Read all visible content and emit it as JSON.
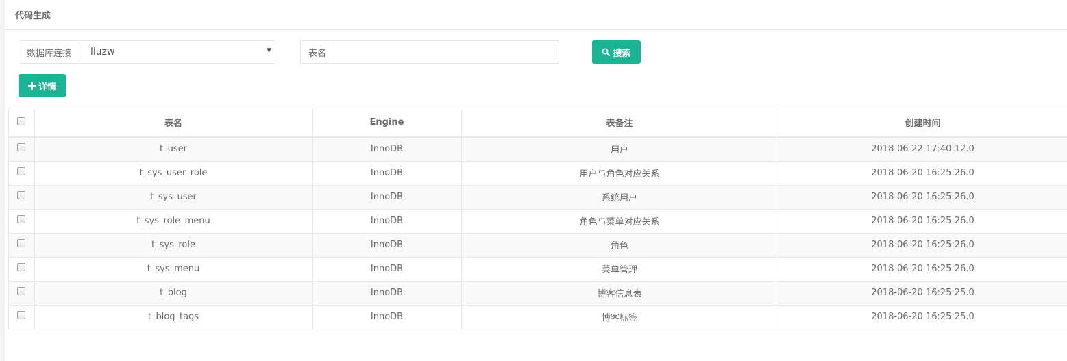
{
  "panel": {
    "title": "代码生成"
  },
  "filters": {
    "db_label": "数据库连接",
    "db_value": "liuzw",
    "table_label": "表名",
    "table_value": "",
    "search_label": "搜索"
  },
  "toolbar": {
    "detail_label": "详情"
  },
  "table": {
    "headers": [
      "表名",
      "Engine",
      "表备注",
      "创建时间"
    ],
    "rows": [
      {
        "name": "t_user",
        "engine": "InnoDB",
        "comment": "用户",
        "created": "2018-06-22 17:40:12.0"
      },
      {
        "name": "t_sys_user_role",
        "engine": "InnoDB",
        "comment": "用户与角色对应关系",
        "created": "2018-06-20 16:25:26.0"
      },
      {
        "name": "t_sys_user",
        "engine": "InnoDB",
        "comment": "系统用户",
        "created": "2018-06-20 16:25:26.0"
      },
      {
        "name": "t_sys_role_menu",
        "engine": "InnoDB",
        "comment": "角色与菜单对应关系",
        "created": "2018-06-20 16:25:26.0"
      },
      {
        "name": "t_sys_role",
        "engine": "InnoDB",
        "comment": "角色",
        "created": "2018-06-20 16:25:26.0"
      },
      {
        "name": "t_sys_menu",
        "engine": "InnoDB",
        "comment": "菜单管理",
        "created": "2018-06-20 16:25:26.0"
      },
      {
        "name": "t_blog",
        "engine": "InnoDB",
        "comment": "博客信息表",
        "created": "2018-06-20 16:25:25.0"
      },
      {
        "name": "t_blog_tags",
        "engine": "InnoDB",
        "comment": "博客标签",
        "created": "2018-06-20 16:25:25.0"
      }
    ]
  },
  "colors": {
    "accent": "#1ab394",
    "border": "#e7eaec",
    "stripe": "#f9f9f9",
    "text": "#676a6c"
  }
}
